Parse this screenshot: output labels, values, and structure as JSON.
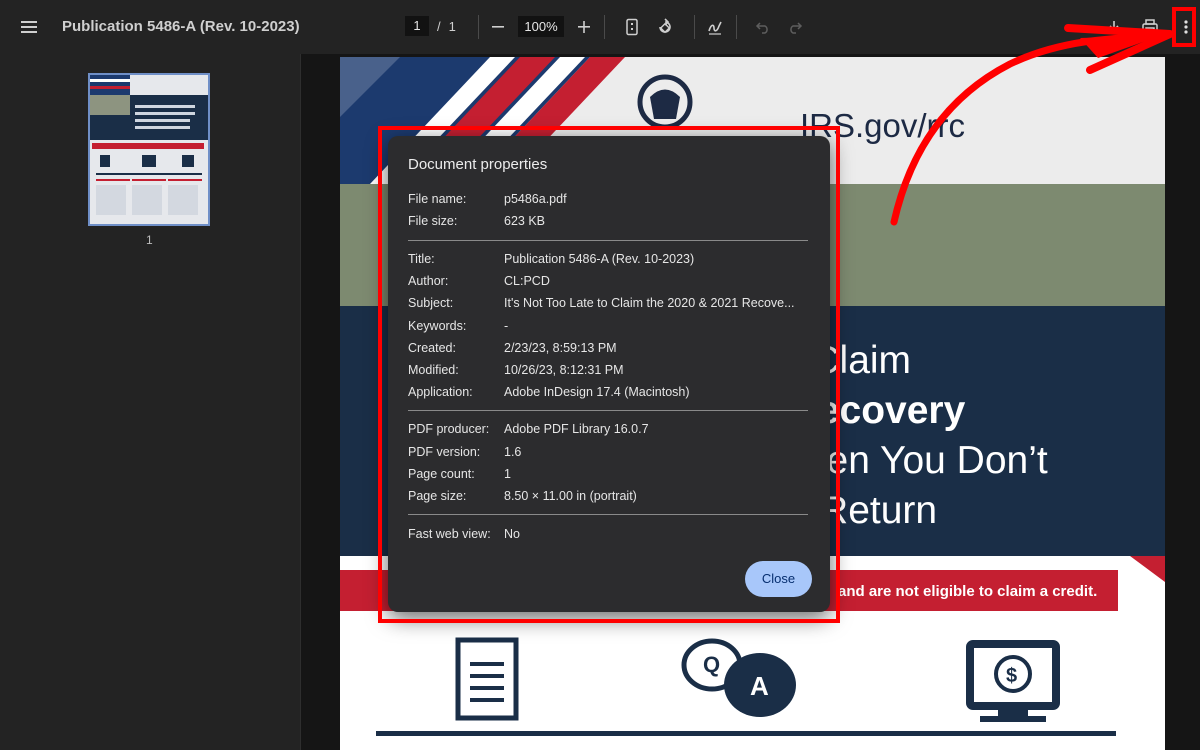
{
  "toolbar": {
    "title": "Publication 5486-A (Rev. 10-2023)",
    "current_page": "1",
    "page_sep": "/",
    "total_pages": "1",
    "zoom": "100%"
  },
  "sidebar": {
    "thumbnail_page_number": "1"
  },
  "page_content": {
    "irs_url": "IRS.gov/rrc",
    "headline_line1": "to Claim",
    "headline_line2": "l Recovery",
    "headline_line3": "When You Don’t",
    "headline_line4": "ax Return",
    "redbar_text": "and are not eligible to claim a credit."
  },
  "dialog": {
    "title": "Document properties",
    "group1": [
      {
        "key": "File name:",
        "value": "p5486a.pdf"
      },
      {
        "key": "File size:",
        "value": "623 KB"
      }
    ],
    "group2": [
      {
        "key": "Title:",
        "value": "Publication 5486-A (Rev. 10-2023)"
      },
      {
        "key": "Author:",
        "value": "CL:PCD"
      },
      {
        "key": "Subject:",
        "value": "It's Not Too Late to Claim the 2020 & 2021 Recove..."
      },
      {
        "key": "Keywords:",
        "value": "-"
      },
      {
        "key": "Created:",
        "value": "2/23/23, 8:59:13 PM"
      },
      {
        "key": "Modified:",
        "value": "10/26/23, 8:12:31 PM"
      },
      {
        "key": "Application:",
        "value": "Adobe InDesign 17.4 (Macintosh)"
      }
    ],
    "group3": [
      {
        "key": "PDF producer:",
        "value": "Adobe PDF Library 16.0.7"
      },
      {
        "key": "PDF version:",
        "value": "1.6"
      },
      {
        "key": "Page count:",
        "value": "1"
      },
      {
        "key": "Page size:",
        "value": "8.50 × 11.00 in (portrait)"
      }
    ],
    "group4": [
      {
        "key": "Fast web view:",
        "value": "No"
      }
    ],
    "close_label": "Close"
  },
  "colors": {
    "annotation": "#ff0000",
    "close_button": "#a8c7fa",
    "dialog_bg": "#2c2c2e"
  }
}
